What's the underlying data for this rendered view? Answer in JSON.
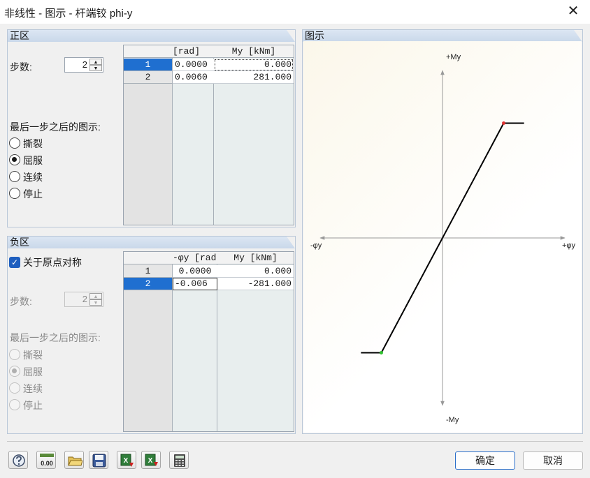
{
  "window": {
    "title": "非线性 - 图示 - 杆端铰 phi-y",
    "close_glyph": "✕"
  },
  "positive": {
    "header": "正区",
    "steps_label": "步数:",
    "steps_value": "2",
    "after_last_label": "最后一步之后的图示:",
    "options": [
      "撕裂",
      "屈服",
      "连续",
      "停止"
    ],
    "selected_option": "屈服",
    "table": {
      "col_headers": [
        "[rad]",
        "My [kNm]"
      ],
      "rows": [
        {
          "no": "1",
          "phi": "0.0000",
          "m": "0.000"
        },
        {
          "no": "2",
          "phi": "0.0060",
          "m": "281.000"
        }
      ]
    }
  },
  "negative": {
    "header": "负区",
    "symmetric_label": "关于原点对称",
    "symmetric_checked": true,
    "steps_label": "步数:",
    "steps_value": "2",
    "after_last_label": "最后一步之后的图示:",
    "options": [
      "撕裂",
      "屈服",
      "连续",
      "停止"
    ],
    "selected_option": "屈服",
    "table": {
      "col_headers": [
        "-φy [rad",
        "My [kNm]"
      ],
      "rows": [
        {
          "no": "1",
          "phi": "0.0000",
          "m": "0.000"
        },
        {
          "no": "2",
          "phi": "-0.006",
          "m": "-281.000"
        }
      ]
    }
  },
  "diagram": {
    "header": "图示",
    "y_pos_label": "+My",
    "y_neg_label": "-My",
    "x_pos_label": "+φy",
    "x_neg_label": "-φy"
  },
  "chart_data": {
    "type": "line",
    "x": [
      -0.008,
      -0.006,
      0.0,
      0.006,
      0.008
    ],
    "series": [
      {
        "values": [
          -281,
          -281,
          0,
          281,
          281
        ]
      }
    ],
    "xlim": [
      -0.012,
      0.012
    ],
    "ylim": [
      -410,
      410
    ],
    "markers": [
      {
        "x": 0.006,
        "y": 281,
        "color": "#e03030"
      },
      {
        "x": -0.006,
        "y": -281,
        "color": "#30c030"
      }
    ],
    "grid": false
  },
  "toolbar": {
    "icons": [
      "help-icon",
      "decimal-places-icon",
      "open-folder-icon",
      "save-icon",
      "export-excel-icon",
      "import-excel-icon",
      "calculator-icon"
    ]
  },
  "buttons": {
    "ok": "确定",
    "cancel": "取消"
  },
  "colors": {
    "selection": "#1f6fd0",
    "curve": "#000000",
    "axis": "#999999"
  }
}
